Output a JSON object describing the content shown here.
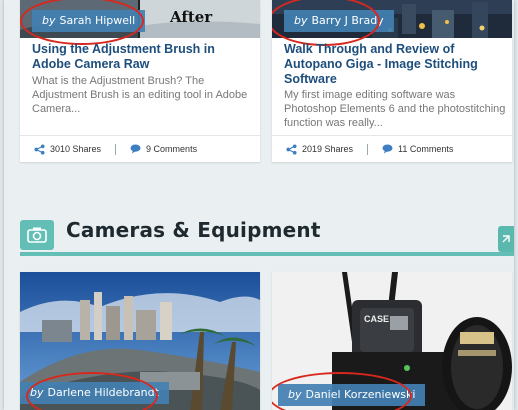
{
  "articles": [
    {
      "author_by": "by",
      "author": "Sarah Hipwell",
      "image_label": "After",
      "title": "Using the Adjustment Brush in Adobe Camera Raw",
      "excerpt": "What is the Adjustment Brush? The Adjustment Brush is an editing tool in Adobe Camera...",
      "shares": "3010 Shares",
      "comments": "9 Comments"
    },
    {
      "author_by": "by",
      "author": "Barry J Brady",
      "title": "Walk Through and Review of Autopano Giga - Image Stitching Software",
      "excerpt": "My first image editing software was Photoshop Elements 6 and the photostitching function was really...",
      "shares": "2019 Shares",
      "comments": "11 Comments"
    }
  ],
  "section": {
    "title": "Cameras & Equipment",
    "icon": "camera-icon",
    "accent_color": "#63bfb5"
  },
  "section_articles": [
    {
      "author_by": "by",
      "author": "Darlene Hildebrandt"
    },
    {
      "author_by": "by",
      "author": "Daniel Korzeniewski",
      "image_brand": "CASE"
    }
  ],
  "colors": {
    "badge": "#4280b2",
    "title": "#1e4e7c",
    "highlight_oval": "#d8281d"
  }
}
